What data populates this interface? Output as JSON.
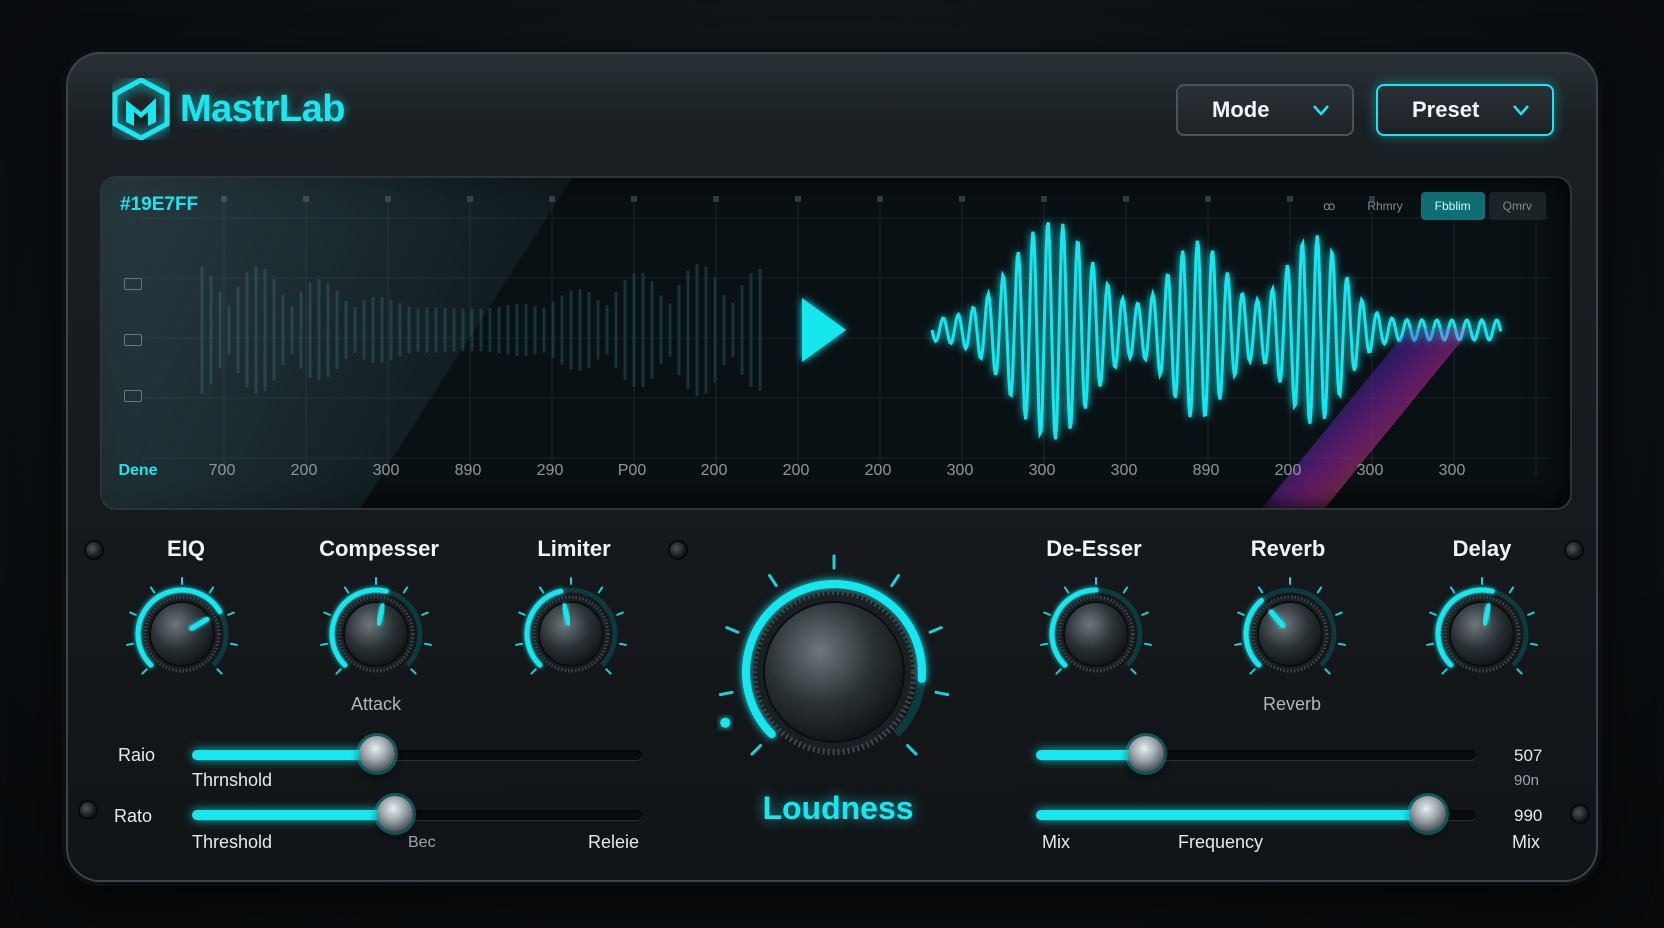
{
  "app": {
    "name": "MastrLab",
    "accent": "#19E7EF"
  },
  "header": {
    "mode_label": "Mode",
    "preset_label": "Preset"
  },
  "display": {
    "readout": "#19E7FF",
    "view_tabs": [
      "ꝏ",
      "Rhmry",
      "Fbblim",
      "Qmrv"
    ],
    "time_labels": [
      "Dene",
      "700",
      "200",
      "300",
      "890",
      "290",
      "P00",
      "200",
      "200",
      "200",
      "300",
      "300",
      "300",
      "890",
      "200",
      "300",
      "300"
    ]
  },
  "modules": {
    "eq": {
      "label": "EIQ",
      "sub": "",
      "value": 0.72
    },
    "compressor": {
      "label": "Compesser",
      "sub": "Attack",
      "value": 0.55
    },
    "limiter": {
      "label": "Limiter",
      "sub": "",
      "value": 0.45
    },
    "loudness": {
      "label": "Loudness",
      "value": 0.85
    },
    "deesser": {
      "label": "De-Esser",
      "sub": "",
      "value": 0.5
    },
    "reverb": {
      "label": "Reverb",
      "sub": "Reverb",
      "value": 0.35
    },
    "delay": {
      "label": "Delay",
      "sub": "",
      "value": 0.55
    }
  },
  "sliders": {
    "left_top": {
      "label": "Raio",
      "caption": "Thrnshold",
      "value": 0.41
    },
    "left_bottom": {
      "label": "Rato",
      "caption": "Threshold",
      "mid_caption": "Bec",
      "end_caption": "Releie",
      "value": 0.45
    },
    "right_top": {
      "value": 0.25,
      "readout1": "507",
      "readout2": "90n"
    },
    "right_bottom": {
      "caption_left": "Mix",
      "caption_mid": "Frequency",
      "caption_right": "Mix",
      "readout": "990",
      "value": 0.89
    }
  }
}
